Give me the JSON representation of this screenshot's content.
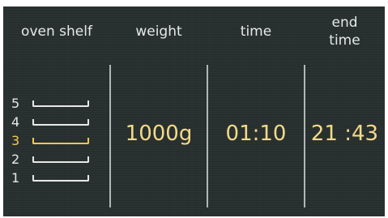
{
  "headers": {
    "shelf": "oven shelf",
    "weight": "weight",
    "time": "time",
    "end_time": "end\ntime"
  },
  "values": {
    "weight": "1000g",
    "time": "01:10",
    "end_time": "21 :43"
  },
  "shelves": [
    {
      "label": "5",
      "active": false
    },
    {
      "label": "4",
      "active": false
    },
    {
      "label": "3",
      "active": true
    },
    {
      "label": "2",
      "active": false
    },
    {
      "label": "1",
      "active": false
    }
  ],
  "colors": {
    "background": "#28302f",
    "text": "#e6e9e6",
    "accent": "#f5c853",
    "value": "#f5d98a"
  }
}
